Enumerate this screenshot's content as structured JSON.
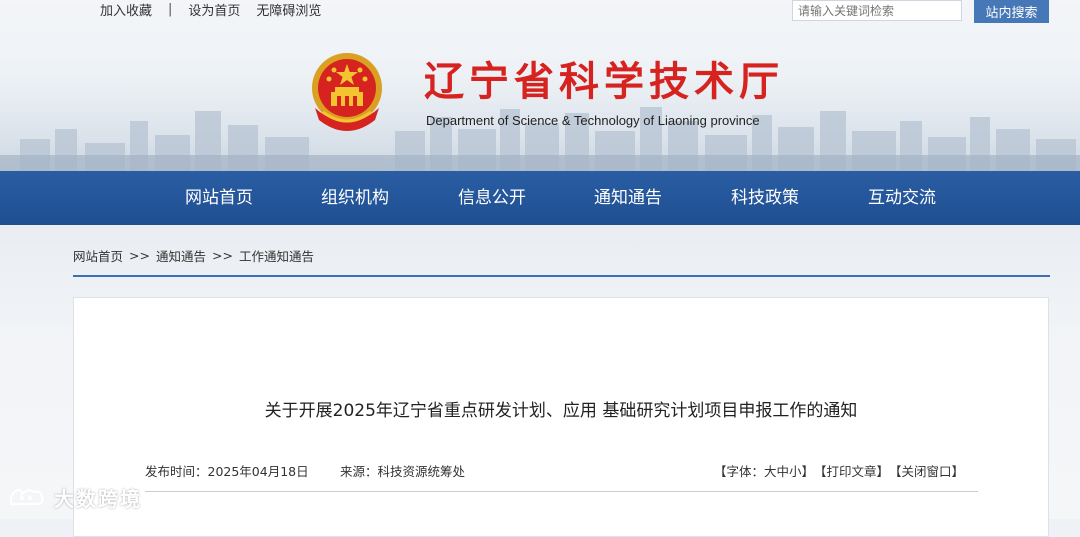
{
  "top_links": {
    "favorite": "加入收藏",
    "separator": "|",
    "homepage": "设为首页",
    "accessible": "无障碍浏览"
  },
  "search": {
    "placeholder": "请输入关键词检索",
    "button": "站内搜索"
  },
  "site": {
    "title": "辽宁省科学技术厅",
    "subtitle": "Department of Science & Technology of Liaoning province"
  },
  "nav": {
    "items": [
      "网站首页",
      "组织机构",
      "信息公开",
      "通知通告",
      "科技政策",
      "互动交流"
    ]
  },
  "breadcrumb": {
    "home": "网站首页",
    "sep": ">>",
    "notices": "通知通告",
    "current": "工作通知通告"
  },
  "article": {
    "title": "关于开展2025年辽宁省重点研发计划、应用 基础研究计划项目申报工作的通知",
    "date_label": "发布时间：2025年04月18日",
    "source_label": "来源：科技资源统筹处",
    "tools": {
      "font": "【字体：大中小】",
      "print": "【打印文章】",
      "close": "【关闭窗口】"
    }
  },
  "watermark": {
    "text": "大数跨境"
  },
  "colors": {
    "brand_red": "#d6231f",
    "nav_blue": "#22549a",
    "search_blue": "#4677b6"
  },
  "icons": {
    "emblem": "national-emblem-icon",
    "watermark": "watermark-logo-icon"
  }
}
